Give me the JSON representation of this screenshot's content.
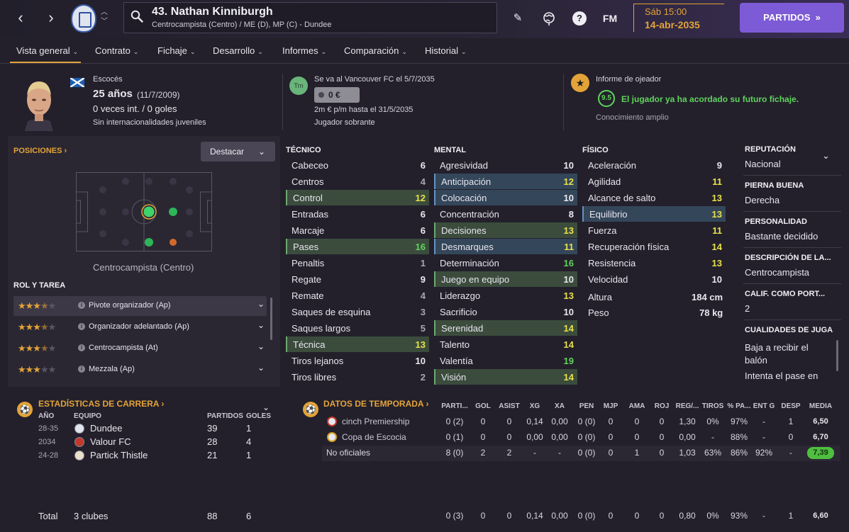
{
  "header": {
    "player_title": "43. Nathan Kinniburgh",
    "player_subtitle": "Centrocampista (Centro) / ME (D), MP (C) - Dundee",
    "fm_label": "FM",
    "date_line1": "Sáb 15:00",
    "date_line2": "14-abr-2035",
    "partidos_label": "PARTIDOS",
    "partidos_arrows": "»"
  },
  "tabs": [
    {
      "label": "Vista general"
    },
    {
      "label": "Contrato"
    },
    {
      "label": "Fichaje"
    },
    {
      "label": "Desarrollo"
    },
    {
      "label": "Informes"
    },
    {
      "label": "Comparación"
    },
    {
      "label": "Historial"
    }
  ],
  "info": {
    "nationality": "Escocés",
    "age": "25 años",
    "dob": "(11/7/2009)",
    "caps": "0 veces int. / 0 goles",
    "youth_caps": "Sin internacionalidades juveniles",
    "transfer_text": "Se va al Vancouver FC el 5/7/2035",
    "tm_label": "Trn",
    "value": "0 €",
    "wage": "2m € p/m hasta el 31/5/2035",
    "squad_status": "Jugador sobrante",
    "scout_title": "Informe de ojeador",
    "scout_score": "9.5",
    "scout_text": "El jugador ya ha acordado su futuro fichaje.",
    "scout_knowledge": "Conocimiento amplio"
  },
  "positions": {
    "title": "POSICIONES",
    "destacar_label": "Destacar",
    "position_label": "Centrocampista (Centro)",
    "role_title": "ROL Y TAREA",
    "roles": [
      {
        "label": "Pivote organizador (Ap)",
        "stars": 3.5
      },
      {
        "label": "Organizador adelantado (Ap)",
        "stars": 3.5
      },
      {
        "label": "Centrocampista (At)",
        "stars": 3.5
      },
      {
        "label": "Mezzala (Ap)",
        "stars": 3
      }
    ]
  },
  "attributes": {
    "tecnico_title": "TÉCNICO",
    "mental_title": "MENTAL",
    "fisico_title": "FÍSICO",
    "tecnico": [
      {
        "name": "Cabeceo",
        "value": "6"
      },
      {
        "name": "Centros",
        "value": "4"
      },
      {
        "name": "Control",
        "value": "12"
      },
      {
        "name": "Entradas",
        "value": "6"
      },
      {
        "name": "Marcaje",
        "value": "6"
      },
      {
        "name": "Pases",
        "value": "16"
      },
      {
        "name": "Penaltis",
        "value": "1"
      },
      {
        "name": "Regate",
        "value": "9"
      },
      {
        "name": "Remate",
        "value": "4"
      },
      {
        "name": "Saques de esquina",
        "value": "3"
      },
      {
        "name": "Saques largos",
        "value": "5"
      },
      {
        "name": "Técnica",
        "value": "13"
      },
      {
        "name": "Tiros lejanos",
        "value": "10"
      },
      {
        "name": "Tiros libres",
        "value": "2"
      }
    ],
    "mental": [
      {
        "name": "Agresividad",
        "value": "10"
      },
      {
        "name": "Anticipación",
        "value": "12"
      },
      {
        "name": "Colocación",
        "value": "10"
      },
      {
        "name": "Concentración",
        "value": "8"
      },
      {
        "name": "Decisiones",
        "value": "13"
      },
      {
        "name": "Desmarques",
        "value": "11"
      },
      {
        "name": "Determinación",
        "value": "16"
      },
      {
        "name": "Juego en equipo",
        "value": "10"
      },
      {
        "name": "Liderazgo",
        "value": "13"
      },
      {
        "name": "Sacrificio",
        "value": "10"
      },
      {
        "name": "Serenidad",
        "value": "14"
      },
      {
        "name": "Talento",
        "value": "14"
      },
      {
        "name": "Valentía",
        "value": "19"
      },
      {
        "name": "Visión",
        "value": "14"
      }
    ],
    "fisico": [
      {
        "name": "Aceleración",
        "value": "9"
      },
      {
        "name": "Agilidad",
        "value": "11"
      },
      {
        "name": "Alcance de salto",
        "value": "13"
      },
      {
        "name": "Equilibrio",
        "value": "13"
      },
      {
        "name": "Fuerza",
        "value": "11"
      },
      {
        "name": "Recuperación física",
        "value": "14"
      },
      {
        "name": "Resistencia",
        "value": "13"
      },
      {
        "name": "Velocidad",
        "value": "10"
      }
    ],
    "height_label": "Altura",
    "height_value": "184 cm",
    "weight_label": "Peso",
    "weight_value": "78 kg"
  },
  "side": {
    "reputation_h": "REPUTACIÓN",
    "reputation_v": "Nacional",
    "foot_h": "PIERNA BUENA",
    "foot_v": "Derecha",
    "personality_h": "PERSONALIDAD",
    "personality_v": "Bastante decidido",
    "description_h": "DESCRIPCIÓN DE LA...",
    "description_v": "Centrocampista",
    "gk_h": "CALIF. COMO PORT...",
    "gk_v": "2",
    "qualities_h": "CUALIDADES DE JUGA",
    "qualities_v1": "Baja a recibir el",
    "qualities_v2": "balón",
    "qualities_v3": "Intenta el pase en"
  },
  "career": {
    "title": "ESTADÍSTICAS DE CARRERA",
    "col_year": "AÑO",
    "col_team": "EQUIPO",
    "col_apps": "PARTIDOS",
    "col_goals": "GOLES",
    "rows": [
      {
        "year": "28-35",
        "team": "Dundee",
        "apps": "39",
        "goals": "1"
      },
      {
        "year": "2034",
        "team": "Valour FC",
        "apps": "28",
        "goals": "4"
      },
      {
        "year": "24-28",
        "team": "Partick Thistle",
        "apps": "21",
        "goals": "1"
      }
    ],
    "total_label": "Total",
    "total_clubs": "3 clubes",
    "total_apps": "88",
    "total_goals": "6"
  },
  "season": {
    "title": "DATOS DE TEMPORADA",
    "columns": [
      "PARTI...",
      "GOL",
      "ASIST",
      "XG",
      "XA",
      "PEN",
      "MJP",
      "AMA",
      "ROJ",
      "REG/...",
      "TIROS",
      "% PA...",
      "ENT G",
      "DESP",
      "MEDIA"
    ],
    "rows": [
      {
        "comp": "cinch Premiership",
        "vals": [
          "0 (2)",
          "0",
          "0",
          "0,14",
          "0,00",
          "0 (0)",
          "0",
          "0",
          "0",
          "1,30",
          "0%",
          "97%",
          "-",
          "1"
        ],
        "media": "6,50"
      },
      {
        "comp": "Copa de Escocia",
        "vals": [
          "0 (1)",
          "0",
          "0",
          "0,00",
          "0,00",
          "0 (0)",
          "0",
          "0",
          "0",
          "0,00",
          "-",
          "88%",
          "-",
          "0"
        ],
        "media": "6,70"
      },
      {
        "comp": "No oficiales",
        "vals": [
          "8 (0)",
          "2",
          "2",
          "-",
          "-",
          "0 (0)",
          "0",
          "1",
          "0",
          "1,03",
          "63%",
          "86%",
          "92%",
          "-"
        ],
        "media": "7,39"
      }
    ],
    "total_vals": [
      "0 (3)",
      "0",
      "0",
      "0,14",
      "0,00",
      "0 (0)",
      "0",
      "0",
      "0",
      "0,80",
      "0%",
      "93%",
      "-",
      "1"
    ],
    "total_media": "6,60"
  }
}
